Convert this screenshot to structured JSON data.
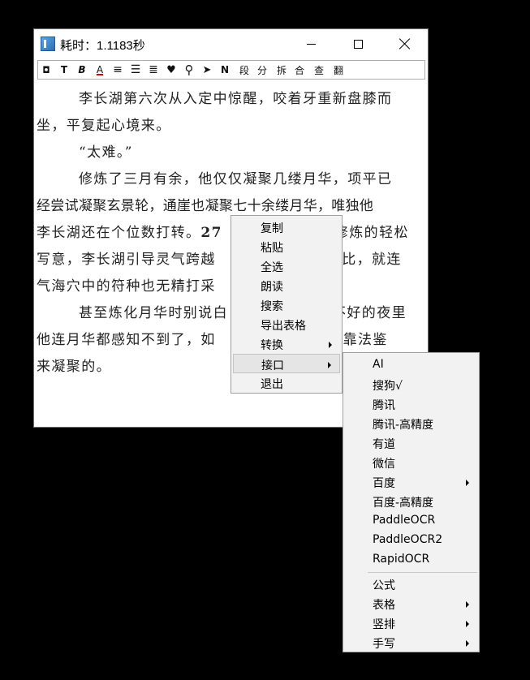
{
  "window": {
    "title": "耗时：1.1183秒"
  },
  "toolbar": {
    "items": [
      {
        "name": "frame-icon",
        "glyph": "◘"
      },
      {
        "name": "text-icon",
        "glyph": "T"
      },
      {
        "name": "bold-icon",
        "glyph": "B"
      },
      {
        "name": "font-color-icon",
        "glyph": "A"
      },
      {
        "name": "align-left-icon",
        "glyph": "≡"
      },
      {
        "name": "align-justify-icon",
        "glyph": "☰"
      },
      {
        "name": "align-right-icon",
        "glyph": "≣"
      },
      {
        "name": "palette-icon",
        "glyph": "♥"
      },
      {
        "name": "search-icon",
        "glyph": "⚲"
      },
      {
        "name": "send-icon",
        "glyph": "➤"
      },
      {
        "name": "n-icon",
        "glyph": "N"
      },
      {
        "name": "segment-button",
        "glyph": "段"
      },
      {
        "name": "split-button",
        "glyph": "分"
      },
      {
        "name": "break-button",
        "glyph": "拆"
      },
      {
        "name": "merge-button",
        "glyph": "合"
      },
      {
        "name": "check-button",
        "glyph": "查"
      },
      {
        "name": "translate-button",
        "glyph": "翻"
      }
    ]
  },
  "content": {
    "line1": "李长湖第六次从入定中惊醒，咬着牙重新盘膝而",
    "line2": "坐，平复起心境来。",
    "line3": "“太难。”",
    "line4": "修炼了三月有余，他仅仅凝聚几缕月华，项平已",
    "line5": "经尝试凝聚玄景轮，通崖也凝聚七十余缕月华，唯独他",
    "line6a": "李长湖还在个位数打转。",
    "line6b": "27",
    "line6c": "修炼的轻松",
    "line7a": "写意，李长湖引导灵气跨越",
    "line7b": "无比，就连",
    "line8": "气海穴中的符种也无精打采",
    "line9a": "甚至炼化月华时别说白",
    "line9b": "不好的夜里",
    "line10a": "他连月华都感知不到了，如",
    "line10b": "是依靠法鉴",
    "line11": "来凝聚的。"
  },
  "context_menu": {
    "items": [
      "复制",
      "粘贴",
      "全选",
      "朗读",
      "搜索",
      "导出表格",
      "转换",
      "接口",
      "退出"
    ]
  },
  "submenu": {
    "items": [
      "AI",
      "搜狗√",
      "腾讯",
      "腾讯-高精度",
      "有道",
      "微信",
      "百度",
      "百度-高精度",
      "PaddleOCR",
      "PaddleOCR2",
      "RapidOCR"
    ],
    "items2": [
      "公式",
      "表格",
      "竖排",
      "手写"
    ]
  }
}
